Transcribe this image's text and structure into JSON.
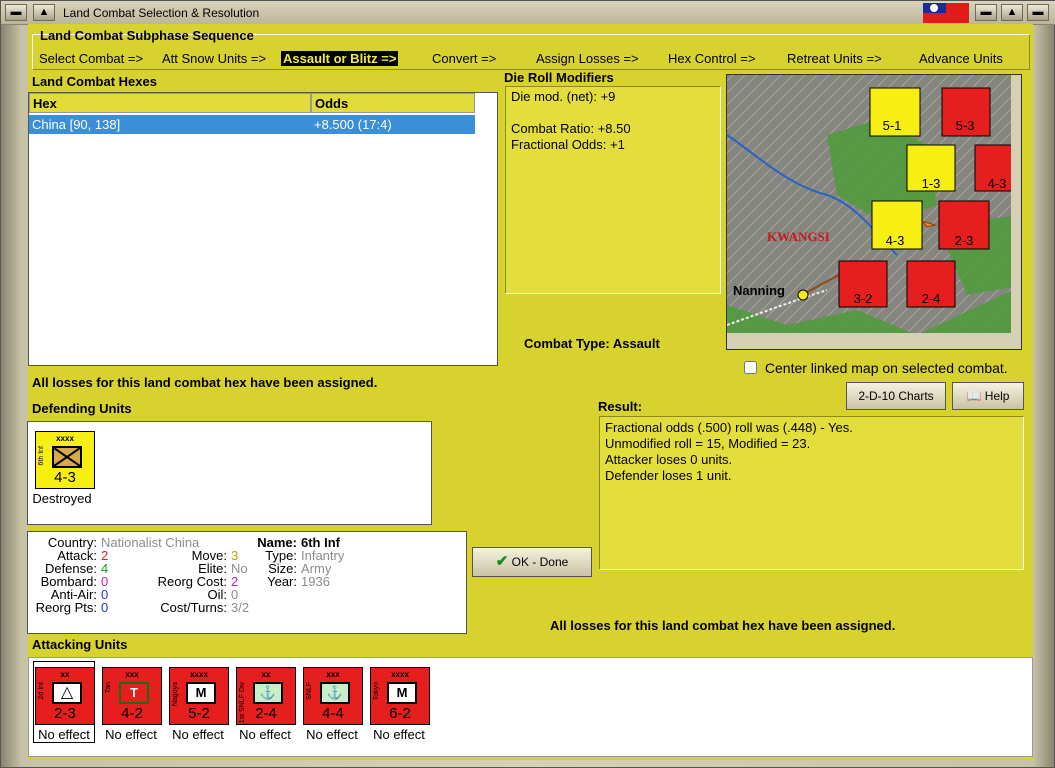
{
  "window": {
    "title": "Land Combat Selection & Resolution"
  },
  "subphase": {
    "header": "Land Combat Subphase Sequence",
    "steps": [
      "Select Combat =>",
      "Att Snow Units =>",
      "Assault or Blitz =>",
      "Convert =>",
      "Assign Losses =>",
      "Hex Control =>",
      "Retreat Units =>",
      "Advance Units"
    ]
  },
  "hexes": {
    "header": "Land Combat Hexes",
    "col_hex": "Hex",
    "col_odds": "Odds",
    "row_hex": "China [90, 138]",
    "row_odds": "+8.500 (17:4)"
  },
  "modifiers": {
    "header": "Die Roll Modifiers",
    "die_mod": "Die mod. (net): +9",
    "combat_ratio": "Combat Ratio: +8.50",
    "fractional_odds": "Fractional Odds: +1"
  },
  "combat_type": "Combat Type:  Assault",
  "losses_msg": "All losses for this land combat hex have been assigned.",
  "losses_msg2": "All losses for this land combat hex have been assigned.",
  "center_map_label": "Center linked map on selected combat.",
  "charts_button": "2-D-10 Charts",
  "help_button": "Help",
  "ok_button": "OK - Done",
  "result": {
    "header": "Result:",
    "lines": [
      "Fractional odds (.500) roll was (.448)  - Yes.",
      "Unmodified roll = 15, Modified = 23.",
      "Attacker loses 0 units.",
      "Defender loses 1 unit."
    ]
  },
  "defending": {
    "header": "Defending Units",
    "unit": {
      "size": "xxxx",
      "side": "6th Inf",
      "value": "4-3",
      "status": "Destroyed"
    }
  },
  "stats": {
    "country_lbl": "Country:",
    "country": "Nationalist China",
    "attack_lbl": "Attack:",
    "attack": "2",
    "defense_lbl": "Defense:",
    "defense": "4",
    "bombard_lbl": "Bombard:",
    "bombard": "0",
    "antiair_lbl": "Anti-Air:",
    "antiair": "0",
    "reorg_lbl": "Reorg Pts:",
    "reorg": "0",
    "move_lbl": "Move:",
    "move": "3",
    "elite_lbl": "Elite:",
    "elite": "No",
    "reorgcost_lbl": "Reorg Cost:",
    "reorgcost": "2",
    "oil_lbl": "Oil:",
    "oil": "0",
    "costturns_lbl": "Cost/Turns:",
    "costturns": "3/2",
    "name_lbl": "Name:",
    "name": "6th Inf",
    "type_lbl": "Type:",
    "type": "Infantry",
    "size_lbl": "Size:",
    "size": "Army",
    "year_lbl": "Year:",
    "year": "1936"
  },
  "attacking": {
    "header": "Attacking Units",
    "units": [
      {
        "size": "xx",
        "side": "2d Inf",
        "value": "2-3",
        "sym": "△",
        "status": "No effect"
      },
      {
        "size": "xxx",
        "side": "Tan",
        "value": "4-2",
        "sym": "T",
        "status": "No effect"
      },
      {
        "size": "xxxx",
        "side": "Nagoya",
        "value": "5-2",
        "sym": "M",
        "status": "No effect"
      },
      {
        "size": "xx",
        "side": "1st SNLF Div",
        "value": "2-4",
        "sym": "⚓",
        "status": "No effect"
      },
      {
        "size": "xxx",
        "side": "SNLF",
        "value": "4-4",
        "sym": "⚓",
        "status": "No effect"
      },
      {
        "size": "xxxx",
        "side": "Tokyo",
        "value": "6-2",
        "sym": "M",
        "status": "No effect"
      }
    ]
  },
  "map": {
    "region": "KWANGSI",
    "city": "Nanning"
  },
  "colors": {
    "panel": "#d8d22f",
    "japan_red": "#e61e1e",
    "china_yellow": "#f7ee12",
    "selection": "#3b8fd8"
  }
}
